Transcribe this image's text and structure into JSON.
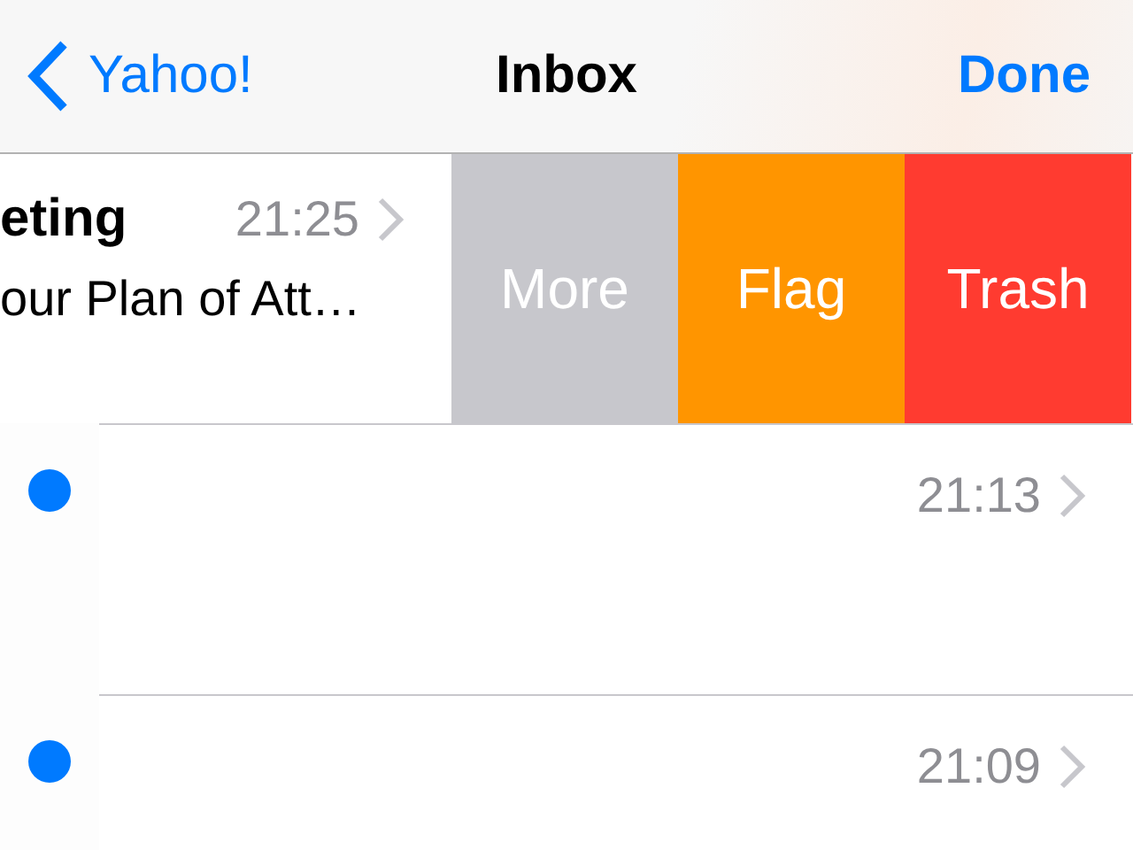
{
  "nav_bar": {
    "back_label": "Yahoo!",
    "title": "Inbox",
    "done_label": "Done"
  },
  "messages": [
    {
      "subject": "eting",
      "time": "21:25",
      "preview": "our Plan of Att…",
      "swiped": true,
      "actions": [
        {
          "label": "More",
          "color": "#c7c7cc"
        },
        {
          "label": "Flag",
          "color": "#ff9500"
        },
        {
          "label": "Trash",
          "color": "#ff3b30"
        }
      ]
    },
    {
      "time": "21:13",
      "unread": true,
      "swiped": false
    },
    {
      "time": "21:09",
      "unread": true,
      "swiped": false
    }
  ]
}
